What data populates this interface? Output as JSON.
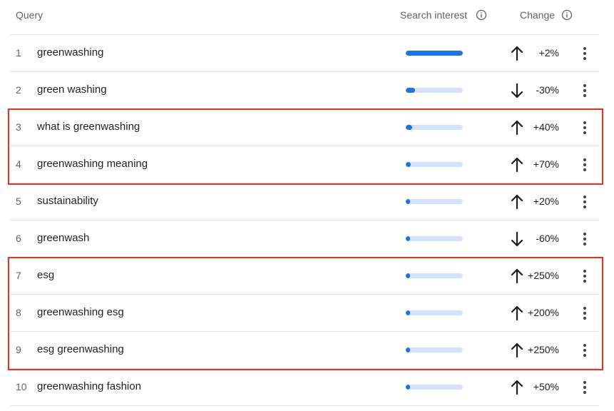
{
  "header": {
    "query_label": "Query",
    "interest_label": "Search interest",
    "change_label": "Change"
  },
  "colors": {
    "bar_fill": "#1a73e8",
    "bar_track": "#d3e3fd",
    "highlight": "#e8321e"
  },
  "rows": [
    {
      "rank": "1",
      "query": "greenwashing",
      "interest": 100,
      "direction": "up",
      "change": "+2%"
    },
    {
      "rank": "2",
      "query": "green washing",
      "interest": 16,
      "direction": "down",
      "change": "-30%"
    },
    {
      "rank": "3",
      "query": "what is greenwashing",
      "interest": 11,
      "direction": "up",
      "change": "+40%"
    },
    {
      "rank": "4",
      "query": "greenwashing meaning",
      "interest": 9,
      "direction": "up",
      "change": "+70%"
    },
    {
      "rank": "5",
      "query": "sustainability",
      "interest": 8,
      "direction": "up",
      "change": "+20%"
    },
    {
      "rank": "6",
      "query": "greenwash",
      "interest": 7,
      "direction": "down",
      "change": "-60%"
    },
    {
      "rank": "7",
      "query": "esg",
      "interest": 5,
      "direction": "up",
      "change": "+250%"
    },
    {
      "rank": "8",
      "query": "greenwashing esg",
      "interest": 5,
      "direction": "up",
      "change": "+200%"
    },
    {
      "rank": "9",
      "query": "esg greenwashing",
      "interest": 5,
      "direction": "up",
      "change": "+250%"
    },
    {
      "rank": "10",
      "query": "greenwashing fashion",
      "interest": 5,
      "direction": "up",
      "change": "+50%"
    }
  ],
  "highlights": [
    {
      "from_rank": "3",
      "to_rank": "4"
    },
    {
      "from_rank": "7",
      "to_rank": "9"
    }
  ]
}
